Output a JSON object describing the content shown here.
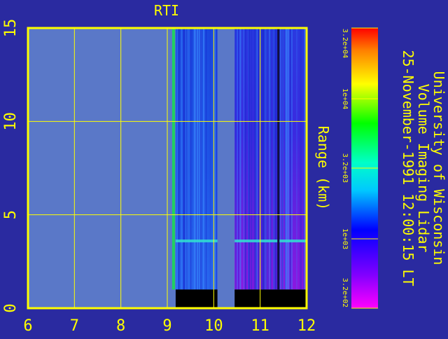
{
  "chart_data": {
    "type": "heatmap",
    "title": "RTI",
    "xlabel": "",
    "ylabel": "Range (km)",
    "xlim": [
      6,
      12
    ],
    "ylim": [
      0,
      15
    ],
    "x_ticks": [
      "6",
      "7",
      "8",
      "9",
      "10",
      "11",
      "12"
    ],
    "y_ticks": [
      "0",
      "5",
      "10",
      "15"
    ],
    "grid": true,
    "colorbar": {
      "scale": "log",
      "range": [
        320,
        32000
      ],
      "tick_labels": [
        "3.2e+04",
        "1e+04",
        "3.2e+03",
        "1e+03",
        "3.2e+02"
      ]
    },
    "data_segments": [
      {
        "x_start": 9.18,
        "x_end": 10.08,
        "y_top": 15
      },
      {
        "x_start": 10.45,
        "x_end": 12.0,
        "y_top": 15
      }
    ],
    "no_data_below_km": 1.0,
    "layer_height_km": 3.6
  },
  "side_text": {
    "line1": "University of Wisconsin",
    "line2": "Volume Imaging Lidar",
    "line3": "25-November-1991 12:00:15 LT"
  },
  "colors": {
    "background": "#2a2aa0",
    "axes": "#ffff00",
    "missing": "#5a78c8"
  }
}
